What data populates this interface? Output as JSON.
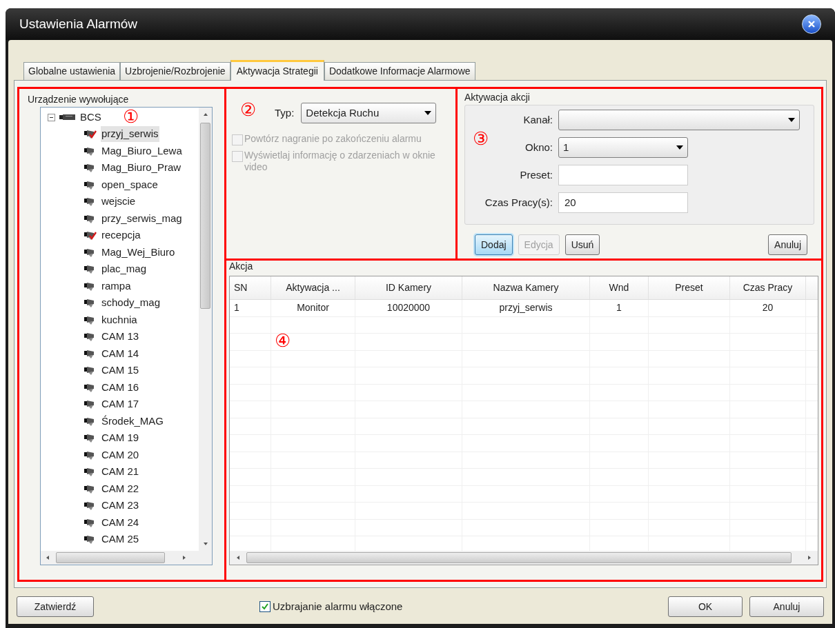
{
  "window": {
    "title": "Ustawienia Alarmów"
  },
  "tabs": [
    {
      "label": "Globalne ustawienia",
      "selected": false
    },
    {
      "label": "Uzbrojenie/Rozbrojenie",
      "selected": false
    },
    {
      "label": "Aktywacja Strategii",
      "selected": true
    },
    {
      "label": "Dodatkowe Informacje Alarmowe",
      "selected": false
    }
  ],
  "annotations": [
    "①",
    "②",
    "③",
    "④"
  ],
  "device_panel": {
    "title": "Urządzenie wywołujące",
    "tree": [
      {
        "label": "BCS",
        "expanded": true,
        "children": [
          {
            "label": "przyj_serwis",
            "alarm": true,
            "selected": true
          },
          {
            "label": "Mag_Biuro_Lewa",
            "alarm": false,
            "selected": false
          },
          {
            "label": "Mag_Biuro_Praw",
            "alarm": false,
            "selected": false
          },
          {
            "label": "open_space",
            "alarm": false,
            "selected": false
          },
          {
            "label": "wejscie",
            "alarm": false,
            "selected": false
          },
          {
            "label": "przy_serwis_mag",
            "alarm": false,
            "selected": false
          },
          {
            "label": "recepcja",
            "alarm": true,
            "selected": false
          },
          {
            "label": "Mag_Wej_Biuro",
            "alarm": false,
            "selected": false
          },
          {
            "label": "plac_mag",
            "alarm": false,
            "selected": false
          },
          {
            "label": "rampa",
            "alarm": false,
            "selected": false
          },
          {
            "label": "schody_mag",
            "alarm": false,
            "selected": false
          },
          {
            "label": "kuchnia",
            "alarm": false,
            "selected": false
          },
          {
            "label": "CAM 13",
            "alarm": false,
            "selected": false
          },
          {
            "label": "CAM 14",
            "alarm": false,
            "selected": false
          },
          {
            "label": "CAM 15",
            "alarm": false,
            "selected": false
          },
          {
            "label": "CAM 16",
            "alarm": false,
            "selected": false
          },
          {
            "label": "CAM 17",
            "alarm": false,
            "selected": false
          },
          {
            "label": "Środek_MAG",
            "alarm": false,
            "selected": false
          },
          {
            "label": "CAM 19",
            "alarm": false,
            "selected": false
          },
          {
            "label": "CAM 20",
            "alarm": false,
            "selected": false
          },
          {
            "label": "CAM 21",
            "alarm": false,
            "selected": false
          },
          {
            "label": "CAM 22",
            "alarm": false,
            "selected": false
          },
          {
            "label": "CAM 23",
            "alarm": false,
            "selected": false
          },
          {
            "label": "CAM 24",
            "alarm": false,
            "selected": false
          },
          {
            "label": "CAM 25",
            "alarm": false,
            "selected": false
          }
        ]
      }
    ]
  },
  "type_panel": {
    "type_label": "Typ:",
    "type_value": "Detekcja Ruchu",
    "options": [
      {
        "label": "Powtórz nagranie po zakończeniu alarmu",
        "checked": false,
        "disabled": true
      },
      {
        "label": "Wyświetlaj informację o zdarzeniach w oknie video",
        "checked": false,
        "disabled": true
      }
    ]
  },
  "action_activation": {
    "title": "Aktywacja akcji",
    "fields": [
      {
        "kind": "dropdown",
        "label": "Kanał:",
        "wide": true
      },
      {
        "kind": "dropdown",
        "label": "Okno:",
        "value": "1",
        "wide": false
      },
      {
        "kind": "text",
        "label": "Preset:",
        "wide": false
      },
      {
        "kind": "text",
        "label": "Czas Pracy(s):",
        "value": "20",
        "wide": false
      }
    ],
    "buttons": [
      {
        "label": "Dodaj",
        "disabled": false,
        "focused": true
      },
      {
        "label": "Edycja",
        "disabled": true,
        "focused": false
      },
      {
        "label": "Usuń",
        "disabled": false,
        "focused": false
      },
      {
        "label": "Anuluj",
        "disabled": false,
        "focused": false
      }
    ]
  },
  "actions_table": {
    "title": "Akcja",
    "columns": [
      "SN",
      "Aktywacja ...",
      "ID Kamery",
      "Nazwa Kamery",
      "Wnd",
      "Preset",
      "Czas Pracy"
    ],
    "rows": [
      [
        "1",
        "Monitor",
        "10020000",
        "przyj_serwis",
        "1",
        null,
        "20"
      ]
    ]
  },
  "footer": {
    "apply_button": "Zatwierdź",
    "arm_checkbox": {
      "label": "Uzbrajanie alarmu włączone",
      "checked": true
    },
    "buttons": [
      "OK",
      "Anuluj"
    ]
  }
}
